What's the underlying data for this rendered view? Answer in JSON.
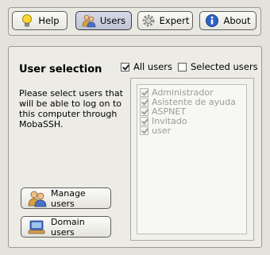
{
  "toolbar": {
    "help_label": "Help",
    "users_label": "Users",
    "expert_label": "Expert",
    "about_label": "About"
  },
  "panel": {
    "title": "User selection",
    "description": "Please select users that will be able to log on to this computer through MobaSSH.",
    "all_users_label": "All users",
    "all_users_checked": true,
    "selected_users_label": "Selected users",
    "selected_users_checked": false,
    "users": [
      {
        "name": "Administrador",
        "checked": true
      },
      {
        "name": "Asistente de ayuda",
        "checked": true
      },
      {
        "name": "ASPNET",
        "checked": true
      },
      {
        "name": "Invitado",
        "checked": true
      },
      {
        "name": "user",
        "checked": true
      }
    ],
    "manage_users_label": "Manage users",
    "domain_users_label": "Domain users"
  }
}
